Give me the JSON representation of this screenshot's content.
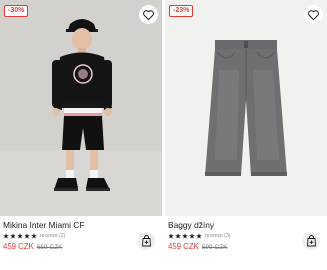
{
  "products": [
    {
      "badge": "-30%",
      "name": "Mikina Inter Miami CF",
      "reviews": "recenze (2)",
      "price": "459 CZK",
      "old_price": "659 CZK",
      "rating": 5,
      "icons": {
        "favorite": "heart-icon",
        "cart": "add-to-cart-icon"
      }
    },
    {
      "badge": "-23%",
      "name": "Baggy džíny",
      "reviews": "recenze (3)",
      "price": "459 CZK",
      "old_price": "599 CZK",
      "rating": 5,
      "icons": {
        "favorite": "heart-icon",
        "cart": "add-to-cart-icon"
      }
    }
  ],
  "colors": {
    "sale_red": "#e53935",
    "star": "#1a1a1a",
    "old_price": "#7a7a7a"
  }
}
